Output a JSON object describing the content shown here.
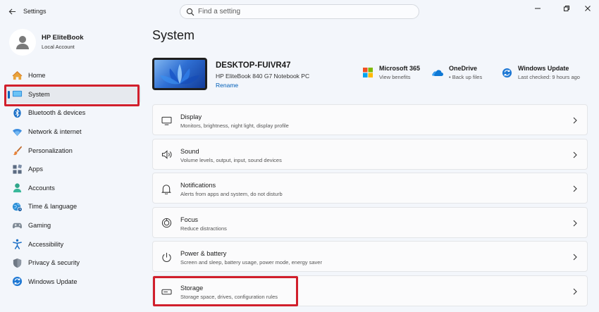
{
  "window": {
    "title": "Settings"
  },
  "search": {
    "placeholder": "Find a setting"
  },
  "profile": {
    "name": "HP EliteBook",
    "account_type": "Local Account"
  },
  "sidebar": {
    "items": [
      {
        "label": "Home",
        "icon": "home-icon"
      },
      {
        "label": "System",
        "icon": "system-icon",
        "active": true
      },
      {
        "label": "Bluetooth & devices",
        "icon": "bluetooth-icon"
      },
      {
        "label": "Network & internet",
        "icon": "network-icon"
      },
      {
        "label": "Personalization",
        "icon": "brush-icon"
      },
      {
        "label": "Apps",
        "icon": "apps-icon"
      },
      {
        "label": "Accounts",
        "icon": "accounts-icon"
      },
      {
        "label": "Time & language",
        "icon": "globe-clock-icon"
      },
      {
        "label": "Gaming",
        "icon": "gamepad-icon"
      },
      {
        "label": "Accessibility",
        "icon": "accessibility-icon"
      },
      {
        "label": "Privacy & security",
        "icon": "shield-icon"
      },
      {
        "label": "Windows Update",
        "icon": "update-icon"
      }
    ]
  },
  "main": {
    "title": "System",
    "device": {
      "name": "DESKTOP-FUIVR47",
      "model": "HP EliteBook 840 G7 Notebook PC",
      "rename_label": "Rename"
    },
    "services": [
      {
        "title": "Microsoft 365",
        "subtitle": "View benefits",
        "icon": "microsoft-365-icon"
      },
      {
        "title": "OneDrive",
        "subtitle": "• Back up files",
        "icon": "onedrive-icon"
      },
      {
        "title": "Windows Update",
        "subtitle": "Last checked: 9 hours ago",
        "icon": "update-icon"
      }
    ],
    "cards": [
      {
        "title": "Display",
        "subtitle": "Monitors, brightness, night light, display profile",
        "icon": "display-icon"
      },
      {
        "title": "Sound",
        "subtitle": "Volume levels, output, input, sound devices",
        "icon": "speaker-icon"
      },
      {
        "title": "Notifications",
        "subtitle": "Alerts from apps and system, do not disturb",
        "icon": "bell-icon"
      },
      {
        "title": "Focus",
        "subtitle": "Reduce distractions",
        "icon": "focus-icon"
      },
      {
        "title": "Power & battery",
        "subtitle": "Screen and sleep, battery usage, power mode, energy saver",
        "icon": "power-icon"
      },
      {
        "title": "Storage",
        "subtitle": "Storage space, drives, configuration rules",
        "icon": "storage-icon"
      }
    ]
  },
  "colors": {
    "accent": "#0067c0",
    "highlight": "#d11f2c",
    "background": "#f3f6fb"
  }
}
